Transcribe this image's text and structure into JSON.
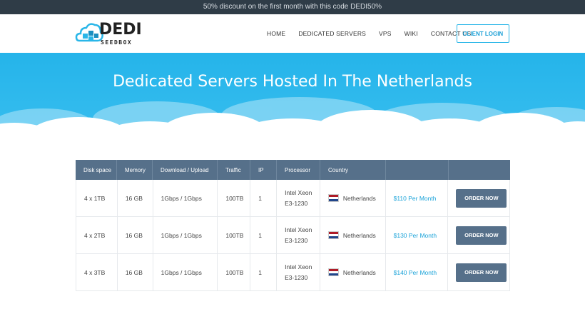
{
  "topbar": {
    "text": "50% discount on the first month with this code DEDI50%"
  },
  "logo": {
    "text": "DEDI",
    "subtext": "SEEDBOX"
  },
  "nav": {
    "items": [
      "HOME",
      "DEDICATED SERVERS",
      "VPS",
      "WIKI",
      "CONTACT US"
    ]
  },
  "header": {
    "login_label": "CLIENT LOGIN"
  },
  "hero": {
    "title": "Dedicated Servers Hosted In The Netherlands"
  },
  "table": {
    "headers": [
      "Disk space",
      "Memory",
      "Download / Upload",
      "Traffic",
      "IP",
      "Processor",
      "Country",
      ""
    ],
    "rows": [
      {
        "disk": "4 x 1TB",
        "memory": "16 GB",
        "bandwidth": "1Gbps / 1Gbps",
        "traffic": "100TB",
        "ip": "1",
        "cpu1": "Intel Xeon",
        "cpu2": "E3-1230",
        "country": "Netherlands",
        "price": "$110 Per Month",
        "order": "ORDER NOW"
      },
      {
        "disk": "4 x 2TB",
        "memory": "16 GB",
        "bandwidth": "1Gbps / 1Gbps",
        "traffic": "100TB",
        "ip": "1",
        "cpu1": "Intel Xeon",
        "cpu2": "E3-1230",
        "country": "Netherlands",
        "price": "$130 Per Month",
        "order": "ORDER NOW"
      },
      {
        "disk": "4 x 3TB",
        "memory": "16 GB",
        "bandwidth": "1Gbps / 1Gbps",
        "traffic": "100TB",
        "ip": "1",
        "cpu1": "Intel Xeon",
        "cpu2": "E3-1230",
        "country": "Netherlands",
        "price": "$140 Per Month",
        "order": "ORDER NOW"
      }
    ]
  },
  "colors": {
    "accent": "#29b6e8",
    "table_header": "#56708a",
    "topbar": "#2f3c47",
    "flag_red": "#ae1c28",
    "flag_blue": "#21468b"
  }
}
